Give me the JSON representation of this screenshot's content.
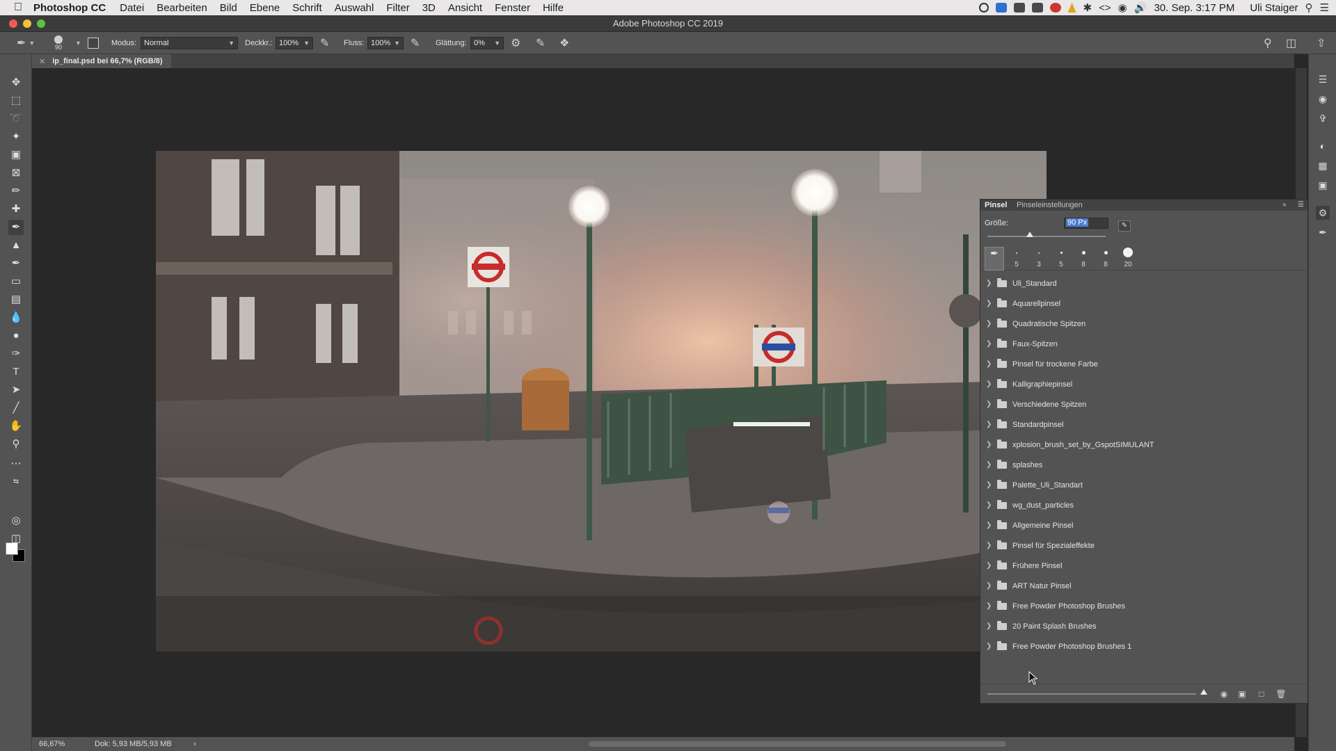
{
  "menubar": {
    "app_name": "Photoshop CC",
    "items": [
      "Datei",
      "Bearbeiten",
      "Bild",
      "Ebene",
      "Schrift",
      "Auswahl",
      "Filter",
      "3D",
      "Ansicht",
      "Fenster",
      "Hilfe"
    ],
    "datetime": "30. Sep.  3:17 PM",
    "user": "Uli Staiger"
  },
  "window": {
    "title": "Adobe Photoshop CC 2019"
  },
  "options_bar": {
    "brush_size": "90",
    "mode_label": "Modus:",
    "mode_value": "Normal",
    "opacity_label": "Deckkr.:",
    "opacity_value": "100%",
    "flow_label": "Fluss:",
    "flow_value": "100%",
    "smoothing_label": "Glättung:",
    "smoothing_value": "0%"
  },
  "document": {
    "tab_label": "ip_final.psd bei 66,7% (RGB/8)",
    "zoom": "66,67%",
    "doc_info": "Dok: 5,93 MB/5,93 MB"
  },
  "brush_panel": {
    "tab_active": "Pinsel",
    "tab_inactive": "Pinseleinstellungen",
    "size_label": "Größe:",
    "size_value": "90 Px",
    "size_slider_fraction": 0.36,
    "presets": [
      "5",
      "3",
      "5",
      "8",
      "8",
      "20"
    ],
    "folders": [
      "Uli_Standard",
      "Aquarellpinsel",
      "Quadratische Spitzen",
      "Faux-Spitzen",
      "Pinsel für trockene Farbe",
      "Kalligraphiepinsel",
      "Verschiedene Spitzen",
      "Standardpinsel",
      "xplosion_brush_set_by_GspotSIMULANT",
      "splashes",
      "Palette_Uli_Standart",
      "wg_dust_particles",
      "Allgemeine Pinsel",
      "Pinsel für Spezialeffekte",
      "Frühere Pinsel",
      "ART Natur Pinsel",
      "Free Powder Photoshop Brushes",
      "20 Paint Splash Brushes",
      "Free Powder Photoshop Brushes 1"
    ]
  },
  "colors": {
    "foreground": "#ffffff",
    "background": "#000000",
    "accent": "#4c7cd0"
  }
}
